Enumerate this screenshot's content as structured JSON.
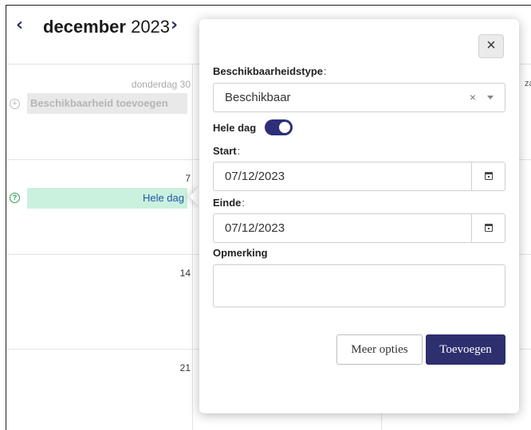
{
  "calendar": {
    "prev_icon": "chevron-left-icon",
    "next_icon": "chevron-right-icon",
    "prev_glyph": "‹",
    "next_glyph": "›",
    "month_name": "december",
    "year": "2023",
    "days": [
      {
        "label": "donderdag 30",
        "muted": true
      },
      {
        "label": "7"
      },
      {
        "label": "14"
      },
      {
        "label": "21"
      }
    ],
    "right_column_label": "za",
    "add_availability": "Beschikbaarheid toevoegen",
    "add_glyph": "+",
    "event_all_day": "Hele dag",
    "help_glyph": "?"
  },
  "popover": {
    "close_glyph": "×",
    "availability_type_label": "Beschikbaarheidstype",
    "required_mark": ":",
    "availability_type_value": "Beschikbaar",
    "clear_glyph": "×",
    "all_day_label": "Hele dag",
    "all_day_on": true,
    "start_label": "Start",
    "start_value": "07/12/2023",
    "end_label": "Einde",
    "end_value": "07/12/2023",
    "remark_label": "Opmerking",
    "remark_value": "",
    "more_options_button": "Meer opties",
    "add_button": "Toevoegen"
  },
  "colors": {
    "primary": "#2d2f6e",
    "event_green": "#c9f1dd",
    "event_text": "#2255aa",
    "help_green": "#2aa05a"
  }
}
